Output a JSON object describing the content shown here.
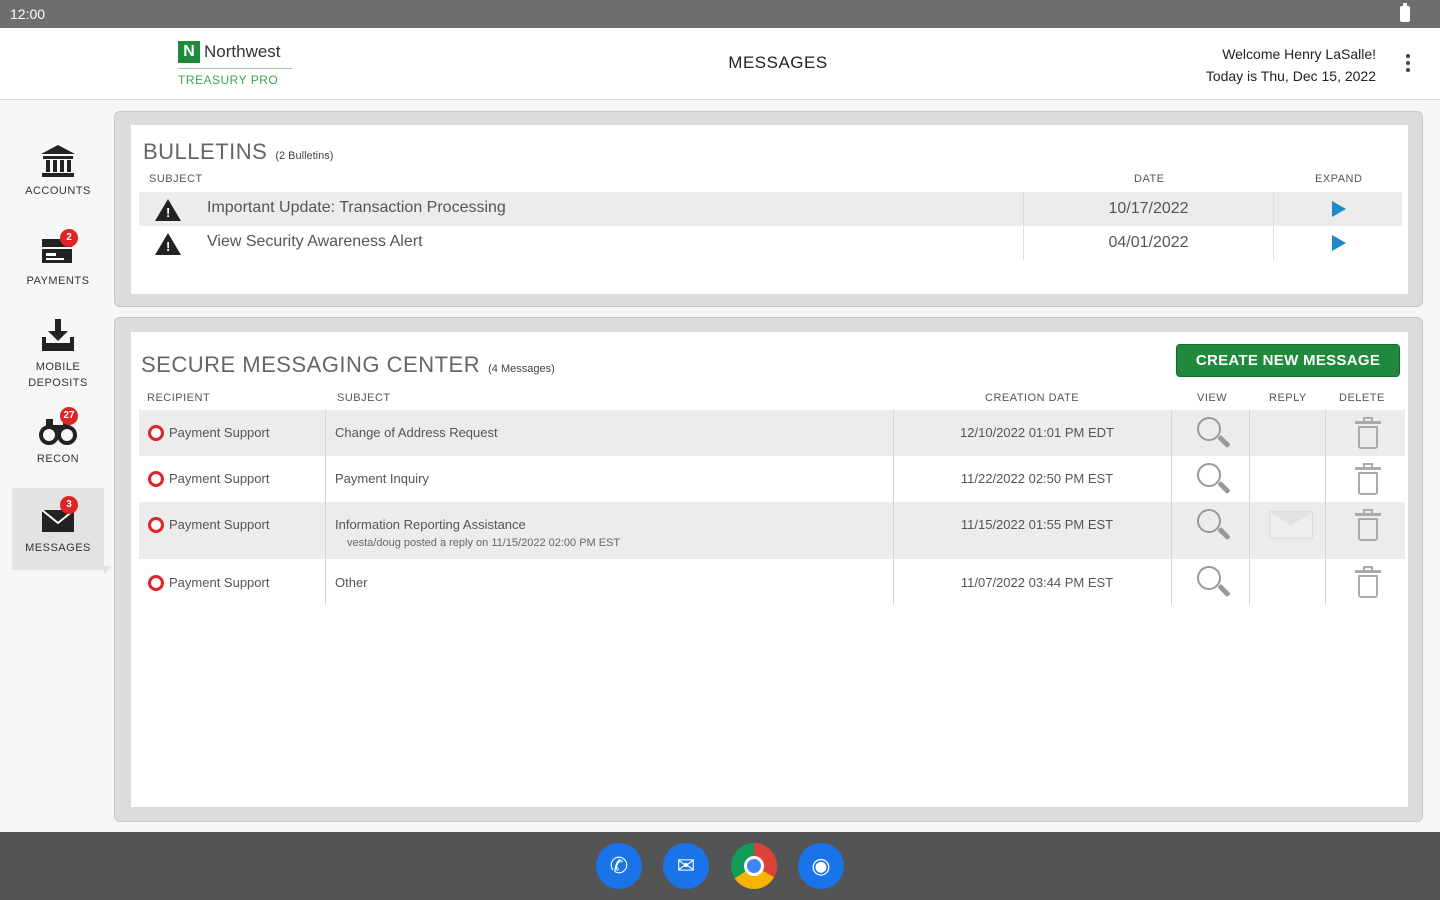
{
  "status_bar": {
    "time": "12:00"
  },
  "header": {
    "logo_mark": "N",
    "logo_name": "Northwest",
    "logo_sub": "TREASURY PRO",
    "title": "MESSAGES",
    "welcome": "Welcome Henry LaSalle!",
    "date_line": "Today is Thu, Dec 15, 2022"
  },
  "sidebar": {
    "items": [
      {
        "label": "ACCOUNTS",
        "icon": "bank-icon",
        "badge": ""
      },
      {
        "label": "PAYMENTS",
        "icon": "payments-icon",
        "badge": "2"
      },
      {
        "label": "MOBILE DEPOSITS",
        "icon": "deposit-icon",
        "badge": ""
      },
      {
        "label": "RECON",
        "icon": "binoculars-icon",
        "badge": "27"
      },
      {
        "label": "MESSAGES",
        "icon": "envelope-icon",
        "badge": "3"
      }
    ]
  },
  "bulletins": {
    "title": "BULLETINS",
    "count": "(2 Bulletins)",
    "columns": {
      "subject": "SUBJECT",
      "date": "DATE",
      "expand": "EXPAND"
    },
    "rows": [
      {
        "subject": "Important Update: Transaction Processing",
        "date": "10/17/2022"
      },
      {
        "subject": "View Security Awareness Alert",
        "date": "04/01/2022"
      }
    ]
  },
  "messages": {
    "title": "SECURE MESSAGING CENTER",
    "count": "(4 Messages)",
    "create_label": "CREATE NEW MESSAGE",
    "columns": {
      "recipient": "RECIPIENT",
      "subject": "SUBJECT",
      "creation_date": "CREATION DATE",
      "view": "VIEW",
      "reply": "REPLY",
      "delete": "DELETE"
    },
    "rows": [
      {
        "recipient": "Payment Support",
        "subject": "Change of Address Request",
        "note": "",
        "date": "12/10/2022 01:01 PM EDT"
      },
      {
        "recipient": "Payment Support",
        "subject": "Payment Inquiry",
        "note": "",
        "date": "11/22/2022 02:50 PM EST"
      },
      {
        "recipient": "Payment Support",
        "subject": "Information Reporting Assistance",
        "note": "vesta/doug posted a reply on 11/15/2022 02:00 PM EST",
        "date": "11/15/2022 01:55 PM EST"
      },
      {
        "recipient": "Payment Support",
        "subject": "Other",
        "note": "",
        "date": "11/07/2022 03:44 PM EST"
      }
    ]
  },
  "colors": {
    "brand_green": "#1f8a3b",
    "badge_red": "#e02424",
    "expand_blue": "#1f88c8"
  }
}
